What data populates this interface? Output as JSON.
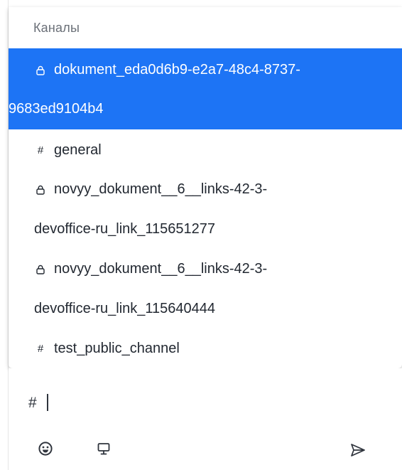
{
  "popup": {
    "title": "Каналы",
    "items": [
      {
        "icon": "lock-icon",
        "line1": "dokument_eda0d6b9-e2a7-48c4-8737-",
        "line2": "9683ed9104b4",
        "selected": true
      },
      {
        "icon": "hash-icon",
        "line1": "general",
        "selected": false
      },
      {
        "icon": "lock-icon",
        "line1": "novyy_dokument__6__links-42-3-",
        "line2": "devoffice-ru_link_115651277",
        "selected": false
      },
      {
        "icon": "lock-icon",
        "line1": "novyy_dokument__6__links-42-3-",
        "line2": "devoffice-ru_link_115640444",
        "selected": false
      },
      {
        "icon": "hash-icon",
        "line1": "test_public_channel",
        "selected": false
      }
    ]
  },
  "composer": {
    "value": "#",
    "tools": [
      "emoji-icon",
      "screen-share-icon"
    ],
    "send_icon": "send-icon"
  },
  "colors": {
    "accent": "#1d74f5",
    "text": "#222831",
    "muted": "#6a6f77"
  }
}
